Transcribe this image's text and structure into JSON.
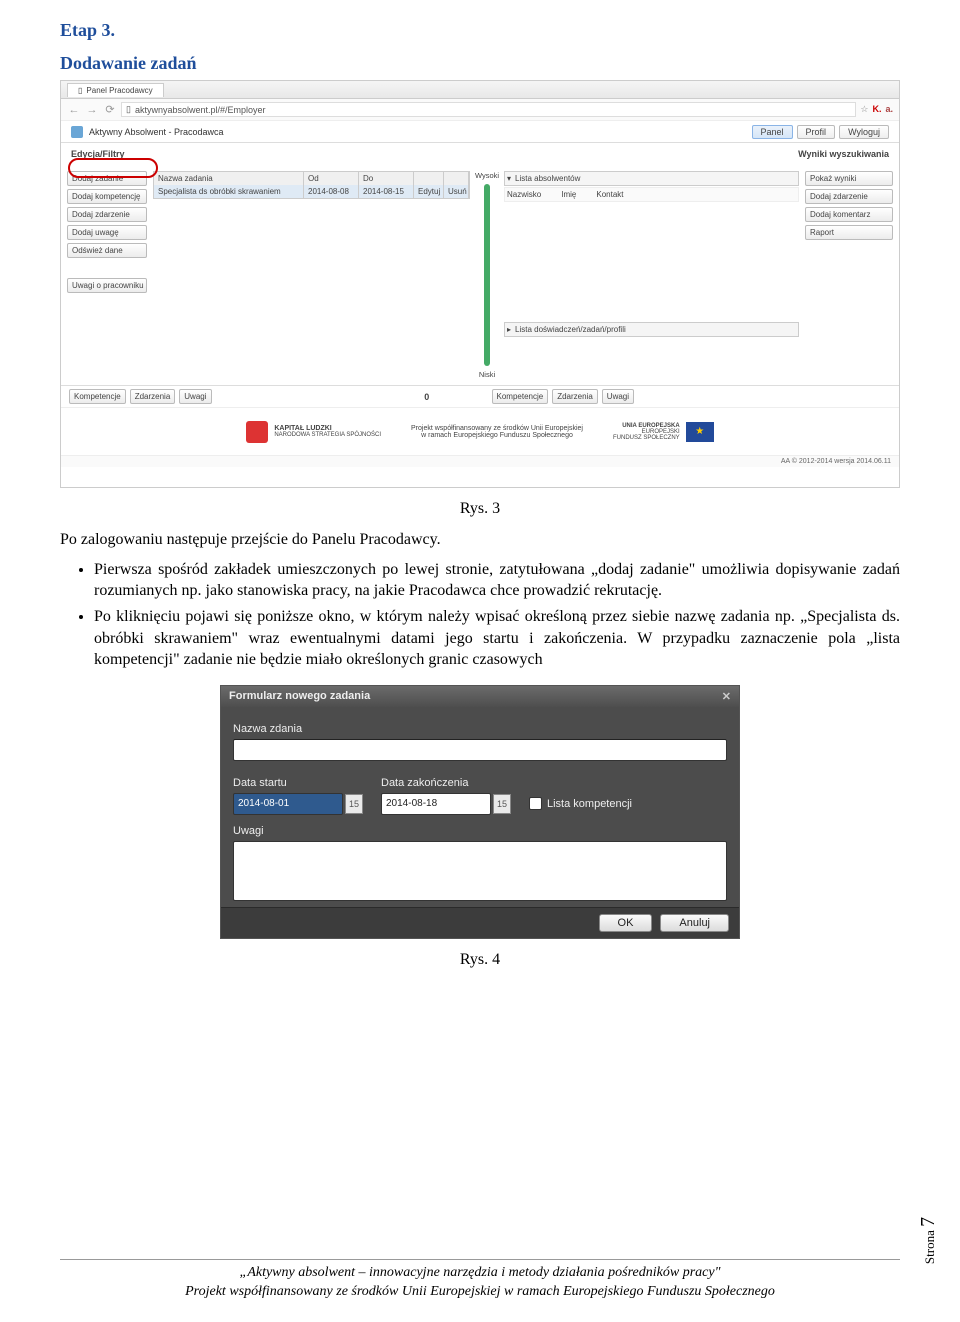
{
  "step_heading": "Etap 3.",
  "subheading": "Dodawanie zadań",
  "caption1": "Rys. 3",
  "intro": "Po zalogowaniu następuje przejście do Panelu Pracodawcy.",
  "bullets": [
    "Pierwsza spośród zakładek umieszczonych po lewej stronie, zatytułowana „dodaj zadanie\" umożliwia dopisywanie zadań rozumianych np. jako stanowiska pracy, na jakie Pracodawca chce prowadzić rekrutację.",
    "Po kliknięciu pojawi się poniższe okno, w którym należy wpisać określoną przez siebie nazwę zadania np. „Specjalista ds. obróbki skrawaniem\" wraz ewentualnymi datami jego startu i zakończenia. W przypadku zaznaczenie pola „lista kompetencji\" zadanie nie będzie miało określonych granic czasowych"
  ],
  "caption2": "Rys. 4",
  "page_side_label": "Strona",
  "page_side_num": "7",
  "footer_l1": "„Aktywny absolwent – innowacyjne narzędzia i metody działania pośredników pracy\"",
  "footer_l2": "Projekt współfinansowany ze środków Unii Europejskiej w ramach Europejskiego Funduszu Społecznego",
  "ssa": {
    "tab": "Panel Pracodawcy",
    "url": "aktywnyabsolwent.pl/#/Employer",
    "brand": "Aktywny Absolwent  -  Pracodawca",
    "nav": {
      "panel": "Panel",
      "profil": "Profil",
      "wyloguj": "Wyloguj"
    },
    "col_left": "Edycja/Filtry",
    "col_right": "Wyniki wyszukiwania",
    "left_btns": [
      "Dodaj zadanie",
      "Dodaj kompetencję",
      "Dodaj zdarzenie",
      "Dodaj uwagę",
      "Odśwież dane",
      "Uwagi o pracowniku"
    ],
    "task_hdr": {
      "nazwa": "Nazwa zadania",
      "od": "Od",
      "do": "Do"
    },
    "task_row": {
      "nazwa": "Specjalista ds obróbki skrawaniem",
      "od": "2014-08-08",
      "do": "2014-08-15",
      "edytuj": "Edytuj",
      "usun": "Usuń"
    },
    "slider_hi": "Wysoki",
    "slider_lo": "Niski",
    "slider_zero": "0",
    "list1": "Lista absolwentów",
    "list1_cols": [
      "Nazwisko",
      "Imię",
      "Kontakt"
    ],
    "list2": "Lista doświadczeń/zadań/profili",
    "right_btns": [
      "Pokaż wyniki",
      "Dodaj zdarzenie",
      "Dodaj komentarz",
      "Raport"
    ],
    "bottom_tabs_l": [
      "Kompetencje",
      "Zdarzenia",
      "Uwagi"
    ],
    "bottom_tabs_r": [
      "Kompetencje",
      "Zdarzenia",
      "Uwagi"
    ],
    "sponsor_left": "KAPITAŁ LUDZKI",
    "sponsor_left_sub": "NARODOWA STRATEGIA SPÓJNOŚCI",
    "sponsor_mid_l1": "Projekt współfinansowany ze środków Unii Europejskiej",
    "sponsor_mid_l2": "w ramach Europejskiego Funduszu Społecznego",
    "sponsor_right_l1": "UNIA EUROPEJSKA",
    "sponsor_right_l2": "EUROPEJSKI",
    "sponsor_right_l3": "FUNDUSZ SPOŁECZNY",
    "footbar": "AA © 2012-2014 wersja 2014.06.11"
  },
  "ssb": {
    "title": "Formularz nowego zadania",
    "lbl_name": "Nazwa zdania",
    "lbl_start": "Data startu",
    "lbl_end": "Data zakończenia",
    "date_start": "2014-08-01",
    "date_end": "2014-08-18",
    "cal_day": "15",
    "chk": "Lista kompetencji",
    "lbl_uwagi": "Uwagi",
    "btn_ok": "OK",
    "btn_cancel": "Anuluj"
  }
}
